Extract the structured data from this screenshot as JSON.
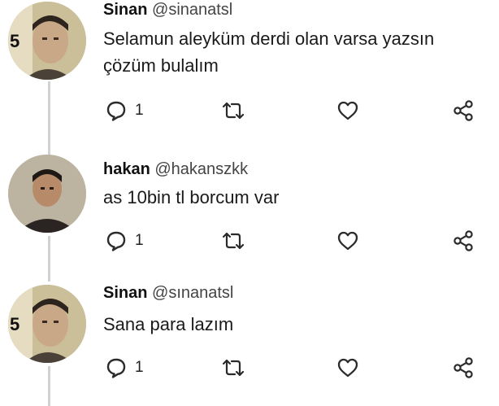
{
  "tweets": [
    {
      "name": "Sinan",
      "handle": "@sinanatsl",
      "lines": [
        "Selamun aleyküm derdi olan varsa yazsın",
        "çözüm bulalım"
      ],
      "reply_count": "1",
      "avatar_badge": "5"
    },
    {
      "name": "hakan",
      "handle": "@hakanszkk",
      "lines": [
        "as 10bin tl borcum var"
      ],
      "reply_count": "1"
    },
    {
      "name": "Sinan",
      "handle": "@sınanatsl",
      "lines": [
        "Sana para lazım"
      ],
      "reply_count": "1",
      "avatar_badge": "5"
    }
  ],
  "icons": {
    "reply": "speech-bubble-icon",
    "retweet": "retweet-icon",
    "like": "heart-icon",
    "share": "share-icon"
  },
  "colors": {
    "icon": "#2b2b2b",
    "thread_line": "#cfd3d6"
  }
}
